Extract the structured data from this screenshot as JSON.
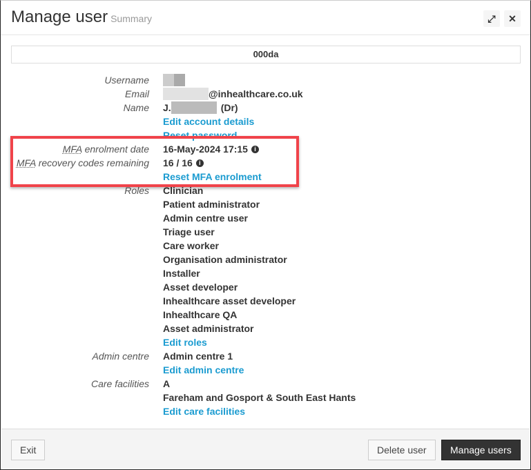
{
  "header": {
    "title": "Manage user",
    "subtitle": "Summary",
    "expand_icon": "expand-icon",
    "close_icon": "close-icon"
  },
  "user_id": "000da",
  "labels": {
    "username": "Username",
    "email": "Email",
    "name": "Name",
    "mfa_abbr": "MFA",
    "mfa_date": " enrolment date",
    "mfa_codes": " recovery codes remaining",
    "roles": "Roles",
    "admin_centre": "Admin centre",
    "care_facilities": "Care facilities"
  },
  "values": {
    "email_suffix": "@inhealthcare.co.uk",
    "name_prefix": "J.",
    "name_suffix": "(Dr)",
    "mfa_date": "16-May-2024 17:15",
    "mfa_codes": "16 / 16"
  },
  "links": {
    "edit_account": "Edit account details",
    "reset_password": "Reset password",
    "reset_mfa": "Reset MFA enrolment",
    "edit_roles": "Edit roles",
    "edit_admin_centre": "Edit admin centre",
    "edit_care_facilities": "Edit care facilities"
  },
  "roles": [
    "Clinician",
    "Patient administrator",
    "Admin centre user",
    "Triage user",
    "Care worker",
    "Organisation administrator",
    "Installer",
    "Asset developer",
    "Inhealthcare asset developer",
    "Inhealthcare QA",
    "Asset administrator"
  ],
  "admin_centre": "Admin centre 1",
  "care_facilities": [
    "A",
    "Fareham and Gosport & South East Hants"
  ],
  "footer": {
    "exit": "Exit",
    "delete": "Delete user",
    "manage": "Manage users"
  },
  "colors": {
    "link": "#1a9bd0",
    "highlight": "#f0434a",
    "primary_button": "#333333"
  }
}
